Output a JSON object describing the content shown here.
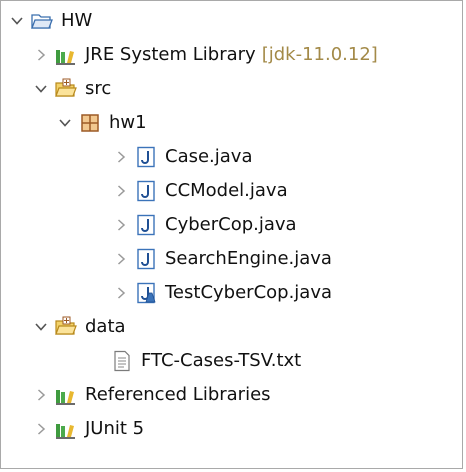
{
  "explorer": {
    "project": {
      "label": "HW"
    },
    "jre": {
      "label": "JRE System Library",
      "decoration": "[jdk-11.0.12]"
    },
    "src": {
      "label": "src"
    },
    "package": {
      "label": "hw1"
    },
    "files": [
      {
        "label": "Case.java"
      },
      {
        "label": "CCModel.java"
      },
      {
        "label": "CyberCop.java"
      },
      {
        "label": "SearchEngine.java"
      },
      {
        "label": "TestCyberCop.java"
      }
    ],
    "data_folder": {
      "label": "data"
    },
    "txt_file": {
      "label": "FTC-Cases-TSV.txt"
    },
    "ref_libs": {
      "label": "Referenced Libraries"
    },
    "junit": {
      "label": "JUnit 5"
    }
  },
  "colors": {
    "decoration": "#a38a48",
    "twistie": "#9a9a9a",
    "twistie_open": "#555555",
    "library_green": "#3f9b3f",
    "library_yellow": "#e8b830",
    "package_brown": "#9c5a26",
    "java_blue": "#3b73b9"
  }
}
